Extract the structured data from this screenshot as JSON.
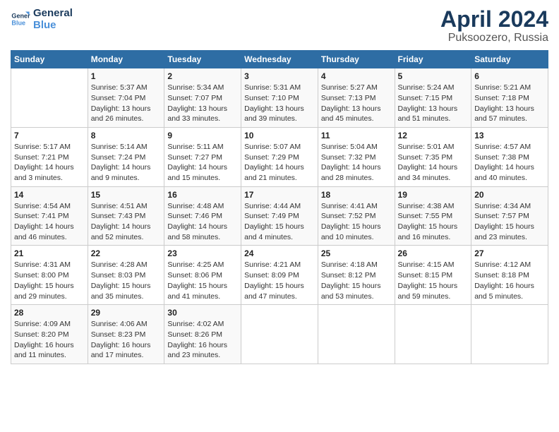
{
  "header": {
    "logo_line1": "General",
    "logo_line2": "Blue",
    "title": "April 2024",
    "subtitle": "Puksoozero, Russia"
  },
  "columns": [
    "Sunday",
    "Monday",
    "Tuesday",
    "Wednesday",
    "Thursday",
    "Friday",
    "Saturday"
  ],
  "weeks": [
    [
      {
        "date": "",
        "info": ""
      },
      {
        "date": "1",
        "info": "Sunrise: 5:37 AM\nSunset: 7:04 PM\nDaylight: 13 hours\nand 26 minutes."
      },
      {
        "date": "2",
        "info": "Sunrise: 5:34 AM\nSunset: 7:07 PM\nDaylight: 13 hours\nand 33 minutes."
      },
      {
        "date": "3",
        "info": "Sunrise: 5:31 AM\nSunset: 7:10 PM\nDaylight: 13 hours\nand 39 minutes."
      },
      {
        "date": "4",
        "info": "Sunrise: 5:27 AM\nSunset: 7:13 PM\nDaylight: 13 hours\nand 45 minutes."
      },
      {
        "date": "5",
        "info": "Sunrise: 5:24 AM\nSunset: 7:15 PM\nDaylight: 13 hours\nand 51 minutes."
      },
      {
        "date": "6",
        "info": "Sunrise: 5:21 AM\nSunset: 7:18 PM\nDaylight: 13 hours\nand 57 minutes."
      }
    ],
    [
      {
        "date": "7",
        "info": "Sunrise: 5:17 AM\nSunset: 7:21 PM\nDaylight: 14 hours\nand 3 minutes."
      },
      {
        "date": "8",
        "info": "Sunrise: 5:14 AM\nSunset: 7:24 PM\nDaylight: 14 hours\nand 9 minutes."
      },
      {
        "date": "9",
        "info": "Sunrise: 5:11 AM\nSunset: 7:27 PM\nDaylight: 14 hours\nand 15 minutes."
      },
      {
        "date": "10",
        "info": "Sunrise: 5:07 AM\nSunset: 7:29 PM\nDaylight: 14 hours\nand 21 minutes."
      },
      {
        "date": "11",
        "info": "Sunrise: 5:04 AM\nSunset: 7:32 PM\nDaylight: 14 hours\nand 28 minutes."
      },
      {
        "date": "12",
        "info": "Sunrise: 5:01 AM\nSunset: 7:35 PM\nDaylight: 14 hours\nand 34 minutes."
      },
      {
        "date": "13",
        "info": "Sunrise: 4:57 AM\nSunset: 7:38 PM\nDaylight: 14 hours\nand 40 minutes."
      }
    ],
    [
      {
        "date": "14",
        "info": "Sunrise: 4:54 AM\nSunset: 7:41 PM\nDaylight: 14 hours\nand 46 minutes."
      },
      {
        "date": "15",
        "info": "Sunrise: 4:51 AM\nSunset: 7:43 PM\nDaylight: 14 hours\nand 52 minutes."
      },
      {
        "date": "16",
        "info": "Sunrise: 4:48 AM\nSunset: 7:46 PM\nDaylight: 14 hours\nand 58 minutes."
      },
      {
        "date": "17",
        "info": "Sunrise: 4:44 AM\nSunset: 7:49 PM\nDaylight: 15 hours\nand 4 minutes."
      },
      {
        "date": "18",
        "info": "Sunrise: 4:41 AM\nSunset: 7:52 PM\nDaylight: 15 hours\nand 10 minutes."
      },
      {
        "date": "19",
        "info": "Sunrise: 4:38 AM\nSunset: 7:55 PM\nDaylight: 15 hours\nand 16 minutes."
      },
      {
        "date": "20",
        "info": "Sunrise: 4:34 AM\nSunset: 7:57 PM\nDaylight: 15 hours\nand 23 minutes."
      }
    ],
    [
      {
        "date": "21",
        "info": "Sunrise: 4:31 AM\nSunset: 8:00 PM\nDaylight: 15 hours\nand 29 minutes."
      },
      {
        "date": "22",
        "info": "Sunrise: 4:28 AM\nSunset: 8:03 PM\nDaylight: 15 hours\nand 35 minutes."
      },
      {
        "date": "23",
        "info": "Sunrise: 4:25 AM\nSunset: 8:06 PM\nDaylight: 15 hours\nand 41 minutes."
      },
      {
        "date": "24",
        "info": "Sunrise: 4:21 AM\nSunset: 8:09 PM\nDaylight: 15 hours\nand 47 minutes."
      },
      {
        "date": "25",
        "info": "Sunrise: 4:18 AM\nSunset: 8:12 PM\nDaylight: 15 hours\nand 53 minutes."
      },
      {
        "date": "26",
        "info": "Sunrise: 4:15 AM\nSunset: 8:15 PM\nDaylight: 15 hours\nand 59 minutes."
      },
      {
        "date": "27",
        "info": "Sunrise: 4:12 AM\nSunset: 8:18 PM\nDaylight: 16 hours\nand 5 minutes."
      }
    ],
    [
      {
        "date": "28",
        "info": "Sunrise: 4:09 AM\nSunset: 8:20 PM\nDaylight: 16 hours\nand 11 minutes."
      },
      {
        "date": "29",
        "info": "Sunrise: 4:06 AM\nSunset: 8:23 PM\nDaylight: 16 hours\nand 17 minutes."
      },
      {
        "date": "30",
        "info": "Sunrise: 4:02 AM\nSunset: 8:26 PM\nDaylight: 16 hours\nand 23 minutes."
      },
      {
        "date": "",
        "info": ""
      },
      {
        "date": "",
        "info": ""
      },
      {
        "date": "",
        "info": ""
      },
      {
        "date": "",
        "info": ""
      }
    ]
  ]
}
